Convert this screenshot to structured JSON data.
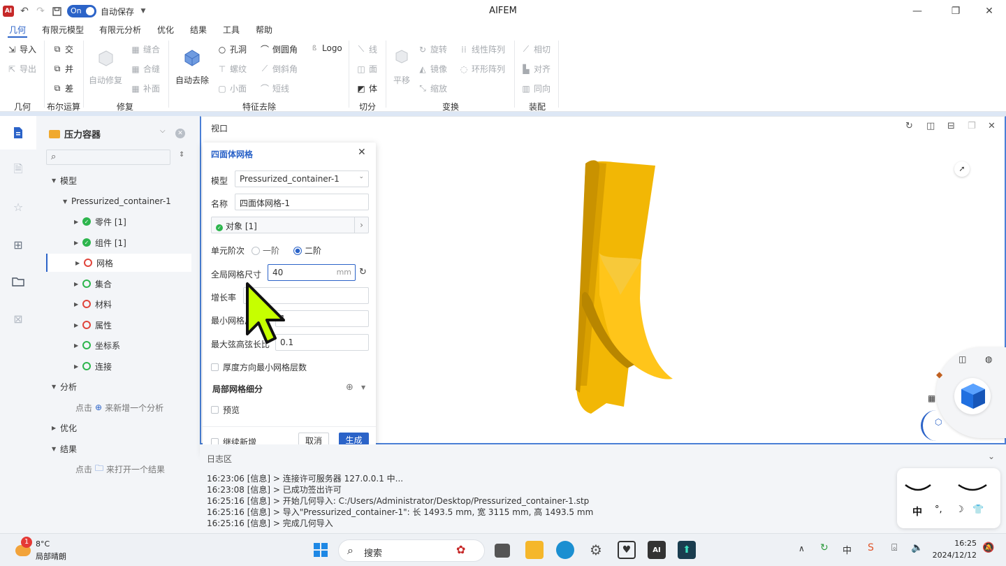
{
  "window": {
    "app_title": "AIFEM",
    "autosave_toggle": "On",
    "autosave_label": "自动保存"
  },
  "menu": {
    "items": [
      "几何",
      "有限元模型",
      "有限元分析",
      "优化",
      "结果",
      "工具",
      "帮助"
    ],
    "active": "几何"
  },
  "ribbon": {
    "geometry": {
      "import": "导入",
      "export": "导出",
      "group": "几何"
    },
    "boolean": {
      "intersect": "交",
      "union": "并",
      "subtract": "差",
      "group": "布尔运算"
    },
    "repair": {
      "auto_repair": "自动修复",
      "stitch": "缝合",
      "merge_seam": "合缝",
      "patch": "补面",
      "group": "修复"
    },
    "feature_removal": {
      "auto_remove": "自动去除",
      "hole": "孔洞",
      "thread": "螺纹",
      "small_face": "小面",
      "fillet": "倒圆角",
      "chamfer": "倒斜角",
      "short_edge": "短线",
      "logo": "Logo",
      "group": "特征去除"
    },
    "cut": {
      "line": "线",
      "face": "面",
      "body": "体",
      "group": "切分"
    },
    "transform": {
      "translate": "平移",
      "rotate": "旋转",
      "mirror": "镜像",
      "scale": "缩放",
      "linear_array": "线性阵列",
      "circular_array": "环形阵列",
      "group": "变换"
    },
    "assembly": {
      "tangent": "相切",
      "align": "对齐",
      "coaxial": "同向",
      "group": "装配"
    }
  },
  "tree": {
    "project": "压力容器",
    "model_label": "模型",
    "part_file": "Pressurized_container-1",
    "items": [
      {
        "label": "零件 [1]",
        "status": "ok"
      },
      {
        "label": "组件 [1]",
        "status": "ok"
      },
      {
        "label": "网格",
        "status": "error"
      },
      {
        "label": "集合",
        "status": "empty-ok"
      },
      {
        "label": "材料",
        "status": "error"
      },
      {
        "label": "属性",
        "status": "error"
      },
      {
        "label": "坐标系",
        "status": "empty-ok"
      },
      {
        "label": "连接",
        "status": "empty-ok"
      }
    ],
    "analysis_label": "分析",
    "analysis_hint_click": "点击",
    "analysis_hint_action": "来新增一个分析",
    "optimize_label": "优化",
    "results_label": "结果",
    "results_hint_click": "点击",
    "results_hint_action": "来打开一个结果"
  },
  "viewport": {
    "title": "视口"
  },
  "dialog": {
    "title": "四面体网格",
    "model_label": "模型",
    "model_value": "Pressurized_container-1",
    "name_label": "名称",
    "name_value": "四面体网格-1",
    "object_value": "对象 [1]",
    "order_label": "单元阶次",
    "order_first": "一阶",
    "order_second": "二阶",
    "global_size_label": "全局网格尺寸",
    "global_size_value": "40",
    "global_size_unit": "mm",
    "growth_label": "增长率",
    "min_size_label": "最小网格尺",
    "min_size_value": "1",
    "max_chord_label": "最大弦高弦长比",
    "max_chord_value": "0.1",
    "thickness_layers": "厚度方向最小网格层数",
    "local_refine": "局部网格细分",
    "preview": "预览",
    "continue_add": "继续新增",
    "cancel": "取消",
    "generate": "生成"
  },
  "log": {
    "title": "日志区",
    "lines": [
      "16:23:06 [信息] > 连接许可服务器 127.0.0.1 中...",
      "16:23:08 [信息] > 已成功签出许可",
      "16:25:16 [信息] > 开始几何导入: C:/Users/Administrator/Desktop/Pressurized_container-1.stp",
      "16:25:16 [信息] > 导入\"Pressurized_container-1\": 长 1493.5 mm, 宽 3115 mm, 高 1493.5 mm",
      "16:25:16 [信息] > 完成几何导入"
    ]
  },
  "ime": {
    "mode": "中",
    "punct": "°,"
  },
  "taskbar": {
    "weather_temp": "8°C",
    "weather_desc": "局部晴朗",
    "weather_badge": "1",
    "search": "搜索",
    "time": "16:25",
    "date": "2024/12/12",
    "ime_indicator": "中"
  },
  "colors": {
    "accent": "#2b63c8",
    "part": "#f2b705",
    "panel": "#f3f5f8"
  }
}
